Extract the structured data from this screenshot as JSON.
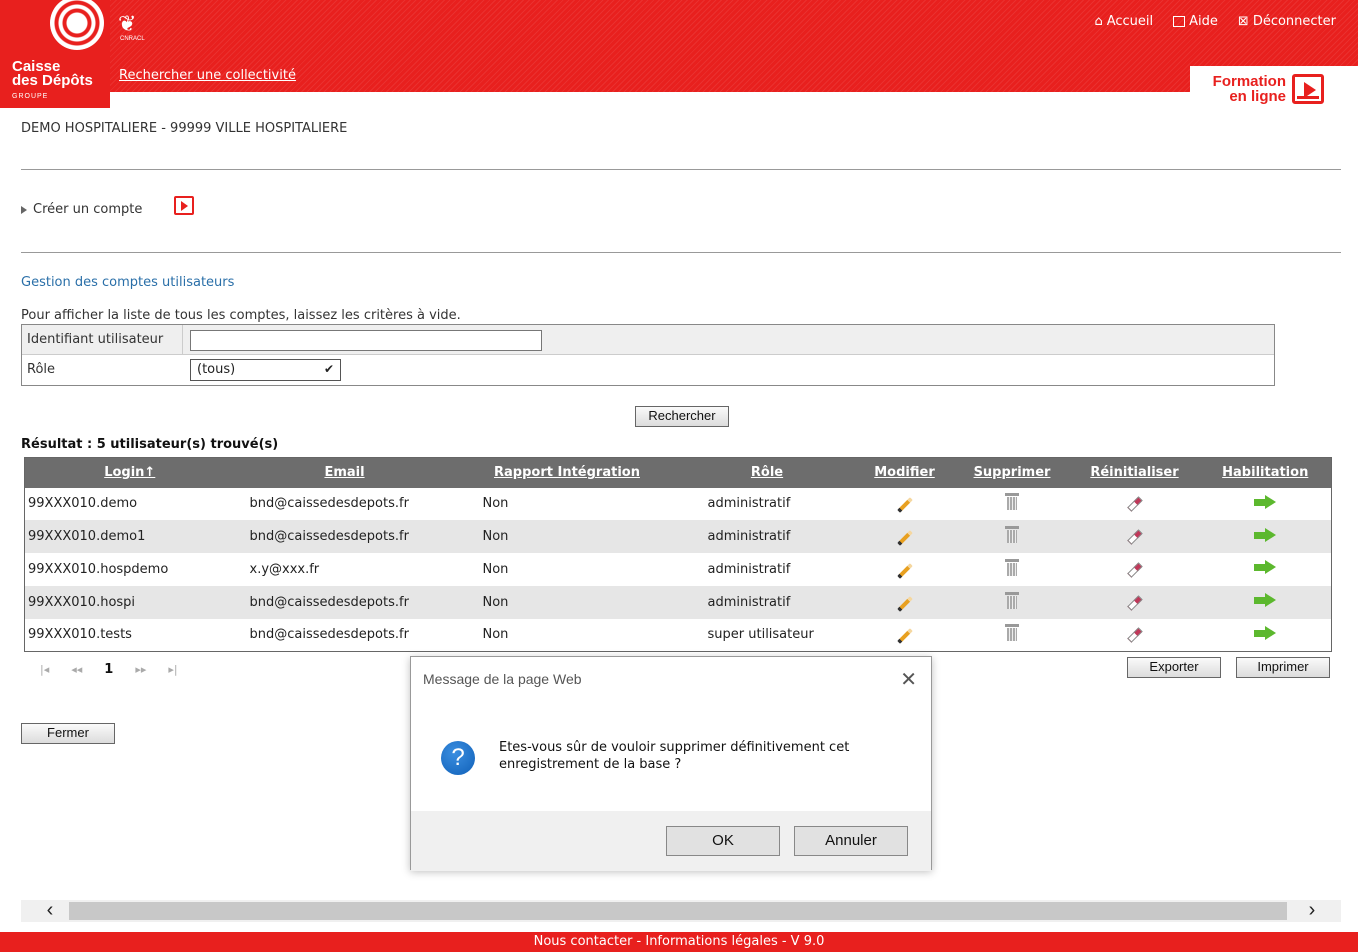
{
  "header": {
    "brand_line1": "Caisse",
    "brand_line2": "des Dépôts",
    "brand_group": "GROUPE",
    "cnracl_label": "CNRACL",
    "search_link": "Rechercher une collectivité",
    "nav": {
      "home": "Accueil",
      "help": "Aide",
      "logout": "Déconnecter"
    },
    "formation_line1": "Formation",
    "formation_line2": "en ligne"
  },
  "collectivite": "DEMO HOSPITALIERE - 99999 VILLE HOSPITALIERE",
  "create_account": "Créer un compte",
  "section_title": "Gestion des comptes utilisateurs",
  "hint": "Pour afficher la liste de tous les comptes, laissez les critères à vide.",
  "criteria": {
    "login_label": "Identifiant utilisateur",
    "login_value": "",
    "role_label": "Rôle",
    "role_value": "(tous)"
  },
  "search_button": "Rechercher",
  "result_title": "Résultat : 5 utilisateur(s) trouvé(s)",
  "table": {
    "headers": [
      "Login↑",
      "Email",
      "Rapport Intégration",
      "Rôle",
      "Modifier",
      "Supprimer",
      "Réinitialiser",
      "Habilitation"
    ],
    "rows": [
      {
        "login": "99XXX010.demo",
        "email": "bnd@caissedesdepots.fr",
        "rapport": "Non",
        "role": "administratif"
      },
      {
        "login": "99XXX010.demo1",
        "email": "bnd@caissedesdepots.fr",
        "rapport": "Non",
        "role": "administratif"
      },
      {
        "login": "99XXX010.hospdemo",
        "email": "x.y@xxx.fr",
        "rapport": "Non",
        "role": "administratif"
      },
      {
        "login": "99XXX010.hospi",
        "email": "bnd@caissedesdepots.fr",
        "rapport": "Non",
        "role": "administratif"
      },
      {
        "login": "99XXX010.tests",
        "email": "bnd@caissedesdepots.fr",
        "rapport": "Non",
        "role": "super utilisateur"
      }
    ]
  },
  "pager": {
    "first": "|◂",
    "prev": "◂◂",
    "current": "1",
    "next": "▸▸",
    "last": "▸|"
  },
  "export_button": "Exporter",
  "print_button": "Imprimer",
  "close_button": "Fermer",
  "dialog": {
    "title": "Message de la page Web",
    "message": "Etes-vous sûr de vouloir supprimer définitivement cet enregistrement de la base ?",
    "ok": "OK",
    "cancel": "Annuler"
  },
  "footer": "Nous contacter - Informations légales - V 9.0",
  "colors": {
    "brand_red": "#e8201e",
    "link_blue": "#2a6fa8",
    "table_header": "#6d6d6d"
  }
}
